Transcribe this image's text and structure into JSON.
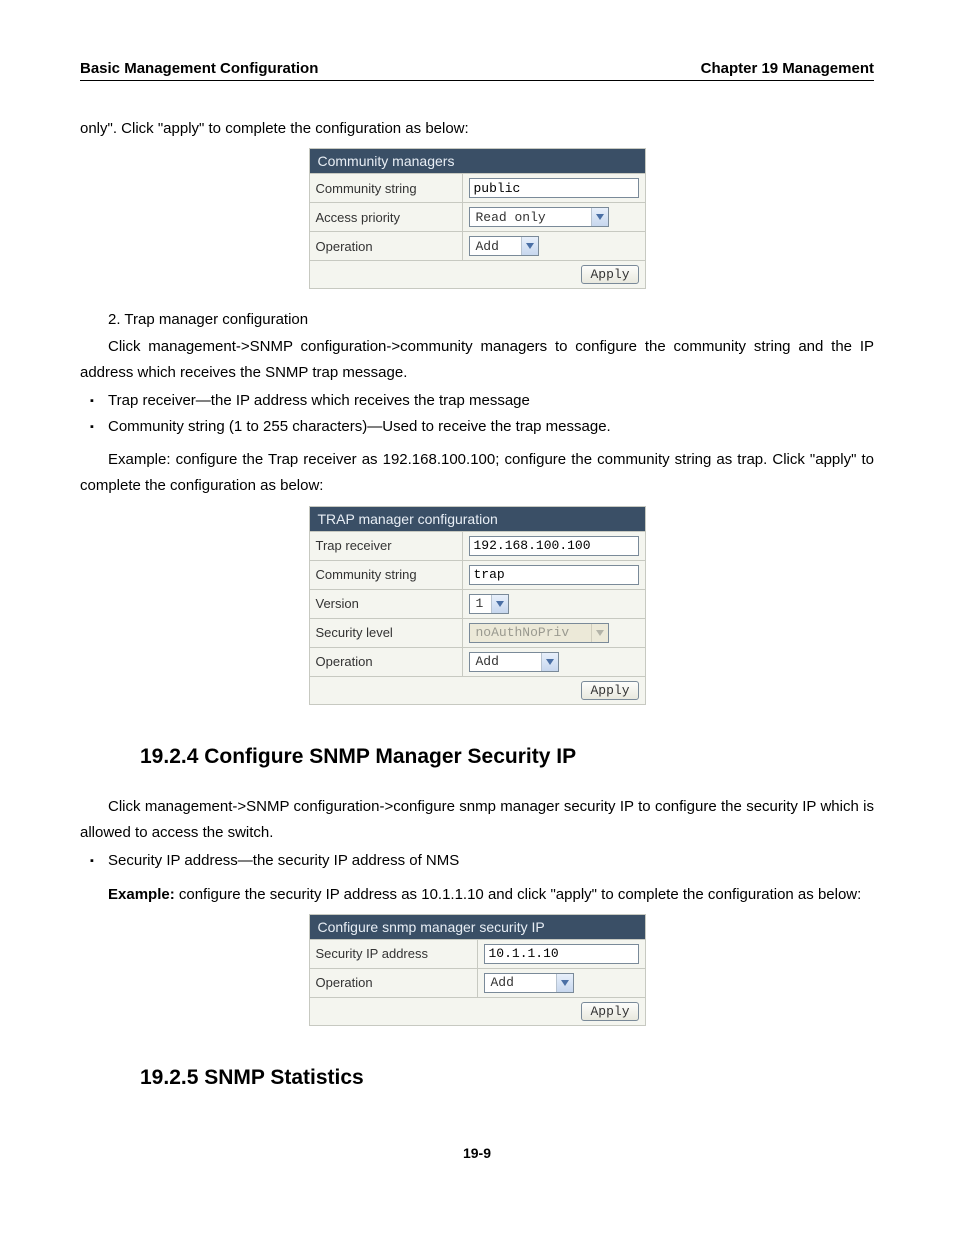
{
  "header": {
    "left": "Basic Management Configuration",
    "right": "Chapter 19 Management"
  },
  "intro_line": "only\". Click \"apply\" to complete the configuration as below:",
  "form1": {
    "title": "Community managers",
    "rows": {
      "community_string_label": "Community string",
      "community_string_value": "public",
      "access_priority_label": "Access priority",
      "access_priority_value": "Read only",
      "operation_label": "Operation",
      "operation_value": "Add"
    },
    "apply": "Apply"
  },
  "trap_section": {
    "line1": "2. Trap manager configuration",
    "line2": "Click management->SNMP configuration->community managers to configure the community string and the IP address which receives the SNMP trap message.",
    "bullets": [
      "Trap receiver—the IP address which receives the trap message",
      "Community string (1 to 255 characters)—Used to receive the trap message."
    ],
    "example": "Example: configure the Trap receiver as 192.168.100.100; configure the community string as trap. Click \"apply\" to complete the configuration as below:"
  },
  "form2": {
    "title": "TRAP manager configuration",
    "rows": {
      "trap_receiver_label": "Trap receiver",
      "trap_receiver_value": "192.168.100.100",
      "community_string_label": "Community string",
      "community_string_value": "trap",
      "version_label": "Version",
      "version_value": "1",
      "security_level_label": "Security level",
      "security_level_value": "noAuthNoPriv",
      "operation_label": "Operation",
      "operation_value": "Add"
    },
    "apply": "Apply"
  },
  "sec_19_2_4": {
    "heading": "19.2.4 Configure SNMP Manager Security IP",
    "p1": "Click management->SNMP configuration->configure snmp manager security IP to configure the security IP which is allowed to access the switch.",
    "bullet": "Security IP address—the security IP address of NMS",
    "example_prefix": "Example:",
    "example_rest": " configure the security IP address as 10.1.1.10 and click \"apply\" to complete the configuration as below:"
  },
  "form3": {
    "title": "Configure snmp manager security IP",
    "rows": {
      "security_ip_label": "Security IP address",
      "security_ip_value": "10.1.1.10",
      "operation_label": "Operation",
      "operation_value": "Add"
    },
    "apply": "Apply"
  },
  "sec_19_2_5": {
    "heading": "19.2.5 SNMP Statistics"
  },
  "page_number": "19-9"
}
